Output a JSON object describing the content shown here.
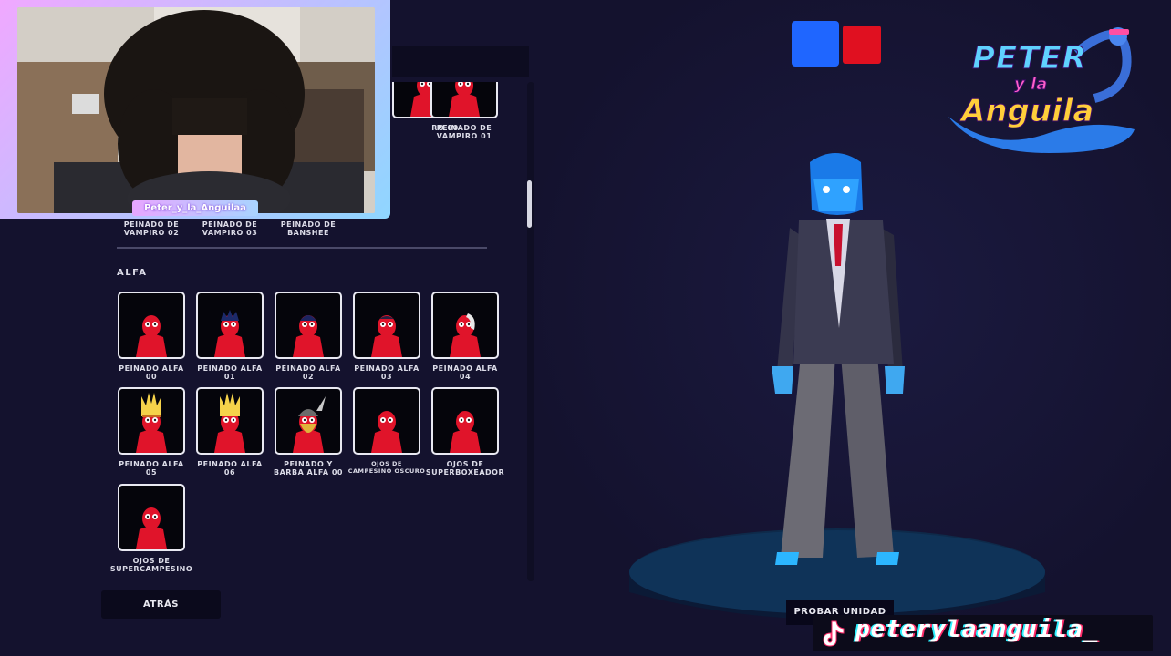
{
  "webcam": {
    "name_tag": "Peter_y_la_Anguilaa"
  },
  "grid_top": [
    {
      "label": "PEINADO DE\nVAMPIRO 00",
      "display": "RO 00"
    },
    {
      "label": "PEINADO DE\nVAMPIRO 01"
    }
  ],
  "grid_prev_row": [
    {
      "label": "PEINADO DE\nVAMPIRO 02"
    },
    {
      "label": "PEINADO DE\nVAMPIRO 03"
    },
    {
      "label": "PEINADO DE\nBANSHEE"
    }
  ],
  "section": {
    "title": "ALFA"
  },
  "items": [
    {
      "label": "PEINADO ALFA\n00",
      "hair": "none"
    },
    {
      "label": "PEINADO ALFA\n01",
      "hair": "spiky-dark"
    },
    {
      "label": "PEINADO ALFA\n02",
      "hair": "dark"
    },
    {
      "label": "PEINADO ALFA\n03",
      "hair": "short-dark"
    },
    {
      "label": "PEINADO ALFA\n04",
      "hair": "white-side"
    },
    {
      "label": "PEINADO ALFA\n05",
      "hair": "blonde-spiky-band"
    },
    {
      "label": "PEINADO ALFA\n06",
      "hair": "blonde-spiky"
    },
    {
      "label": "PEINADO Y\nBARBA ALFA 00",
      "hair": "viking"
    },
    {
      "label": "OJOS DE\nCAMPESINO OSCURO",
      "hair": "none",
      "small": true
    },
    {
      "label": "OJOS DE\nSUPERBOXEADOR",
      "hair": "none"
    },
    {
      "label": "OJOS DE\nSUPERCAMPESINO",
      "hair": "none"
    }
  ],
  "buttons": {
    "back": "ATRÁS",
    "try_unit": "PROBAR UNIDAD"
  },
  "teams": {
    "blue": "#1f66ff",
    "red": "#e01020"
  },
  "logo": {
    "line1": "PETER",
    "line2": "y la",
    "line3": "Anguila"
  },
  "tiktok": {
    "handle": "peterylaanguila_",
    "icon": "tiktok-icon"
  }
}
